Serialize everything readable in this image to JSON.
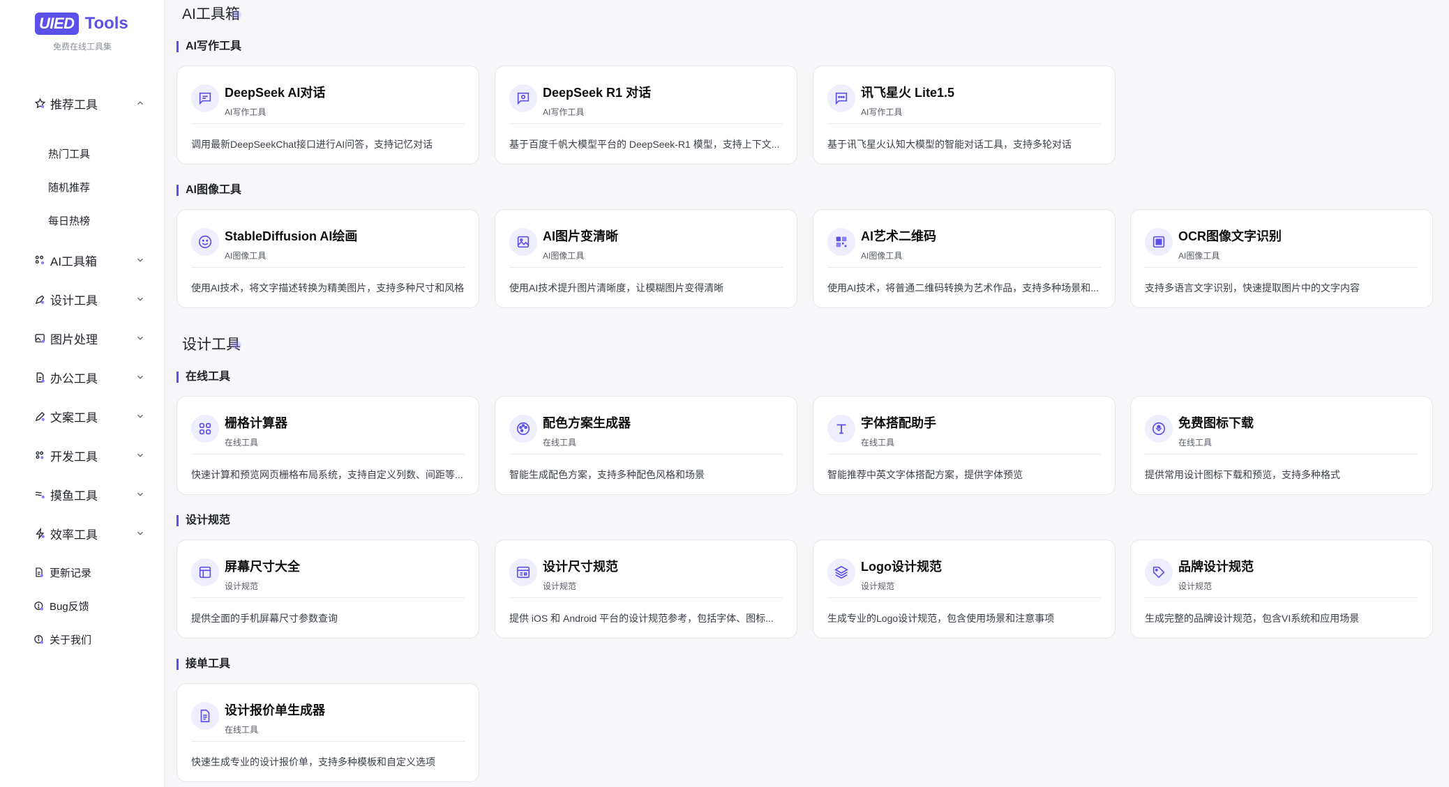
{
  "brand": {
    "logo_box": "UIED",
    "logo_text": "Tools",
    "subtitle": "免费在线工具集",
    "accent": "#5b50e8"
  },
  "sidebar": {
    "recommend": {
      "label": "推荐工具",
      "icon": "star-icon",
      "expanded": true,
      "children": [
        "热门工具",
        "随机推荐",
        "每日热榜"
      ]
    },
    "groups": [
      {
        "label": "AI工具箱",
        "icon": "ai-grid-icon"
      },
      {
        "label": "设计工具",
        "icon": "pen-tool-icon"
      },
      {
        "label": "图片处理",
        "icon": "image-icon"
      },
      {
        "label": "办公工具",
        "icon": "document-icon"
      },
      {
        "label": "文案工具",
        "icon": "pencil-icon"
      },
      {
        "label": "开发工具",
        "icon": "code-icon"
      },
      {
        "label": "摸鱼工具",
        "icon": "fish-icon"
      },
      {
        "label": "效率工具",
        "icon": "bolt-icon"
      }
    ],
    "links": [
      {
        "label": "更新记录",
        "icon": "changelog-icon"
      },
      {
        "label": "Bug反馈",
        "icon": "bug-icon"
      },
      {
        "label": "关于我们",
        "icon": "info-icon"
      }
    ]
  },
  "sections": [
    {
      "title": "AI工具箱",
      "groups": [
        {
          "title": "AI写作工具",
          "cards": [
            {
              "title": "DeepSeek AI对话",
              "category": "AI写作工具",
              "desc": "调用最新DeepSeekChat接口进行AI问答，支持记忆对话",
              "icon": "chat-lines-icon"
            },
            {
              "title": "DeepSeek R1 对话",
              "category": "AI写作工具",
              "desc": "基于百度千帆大模型平台的 DeepSeek-R1 模型，支持上下文...",
              "icon": "chat-bot-icon"
            },
            {
              "title": "讯飞星火 Lite1.5",
              "category": "AI写作工具",
              "desc": "基于讯飞星火认知大模型的智能对话工具，支持多轮对话",
              "icon": "chat-dots-icon"
            }
          ]
        },
        {
          "title": "AI图像工具",
          "cards": [
            {
              "title": "StableDiffusion AI绘画",
              "category": "AI图像工具",
              "desc": "使用AI技术，将文字描述转换为精美图片，支持多种尺寸和风格",
              "icon": "smile-icon"
            },
            {
              "title": "AI图片变清晰",
              "category": "AI图像工具",
              "desc": "使用AI技术提升图片清晰度，让模糊图片变得清晰",
              "icon": "image-icon"
            },
            {
              "title": "AI艺术二维码",
              "category": "AI图像工具",
              "desc": "使用AI技术，将普通二维码转换为艺术作品，支持多种场景和...",
              "icon": "qrcode-icon"
            },
            {
              "title": "OCR图像文字识别",
              "category": "AI图像工具",
              "desc": "支持多语言文字识别，快速提取图片中的文字内容",
              "icon": "scan-icon"
            }
          ]
        }
      ]
    },
    {
      "title": "设计工具",
      "groups": [
        {
          "title": "在线工具",
          "cards": [
            {
              "title": "栅格计算器",
              "category": "在线工具",
              "desc": "快速计算和预览网页栅格布局系统，支持自定义列数、间距等...",
              "icon": "grid-icon"
            },
            {
              "title": "配色方案生成器",
              "category": "在线工具",
              "desc": "智能生成配色方案，支持多种配色风格和场景",
              "icon": "palette-icon"
            },
            {
              "title": "字体搭配助手",
              "category": "在线工具",
              "desc": "智能推荐中英文字体搭配方案，提供字体预览",
              "icon": "type-icon"
            },
            {
              "title": "免费图标下载",
              "category": "在线工具",
              "desc": "提供常用设计图标下载和预览，支持多种格式",
              "icon": "badge-icon"
            }
          ]
        },
        {
          "title": "设计规范",
          "cards": [
            {
              "title": "屏幕尺寸大全",
              "category": "设计规范",
              "desc": "提供全面的手机屏幕尺寸参数查询",
              "icon": "layout-icon"
            },
            {
              "title": "设计尺寸规范",
              "category": "设计规范",
              "desc": "提供 iOS 和 Android 平台的设计规范参考，包括字体、图标...",
              "icon": "browser-icon"
            },
            {
              "title": "Logo设计规范",
              "category": "设计规范",
              "desc": "生成专业的Logo设计规范，包含使用场景和注意事项",
              "icon": "layers-icon"
            },
            {
              "title": "品牌设计规范",
              "category": "设计规范",
              "desc": "生成完整的品牌设计规范，包含VI系统和应用场景",
              "icon": "tag-icon"
            }
          ]
        },
        {
          "title": "接单工具",
          "cards": [
            {
              "title": "设计报价单生成器",
              "category": "在线工具",
              "desc": "快速生成专业的设计报价单，支持多种模板和自定义选项",
              "icon": "invoice-icon"
            }
          ]
        }
      ]
    }
  ]
}
